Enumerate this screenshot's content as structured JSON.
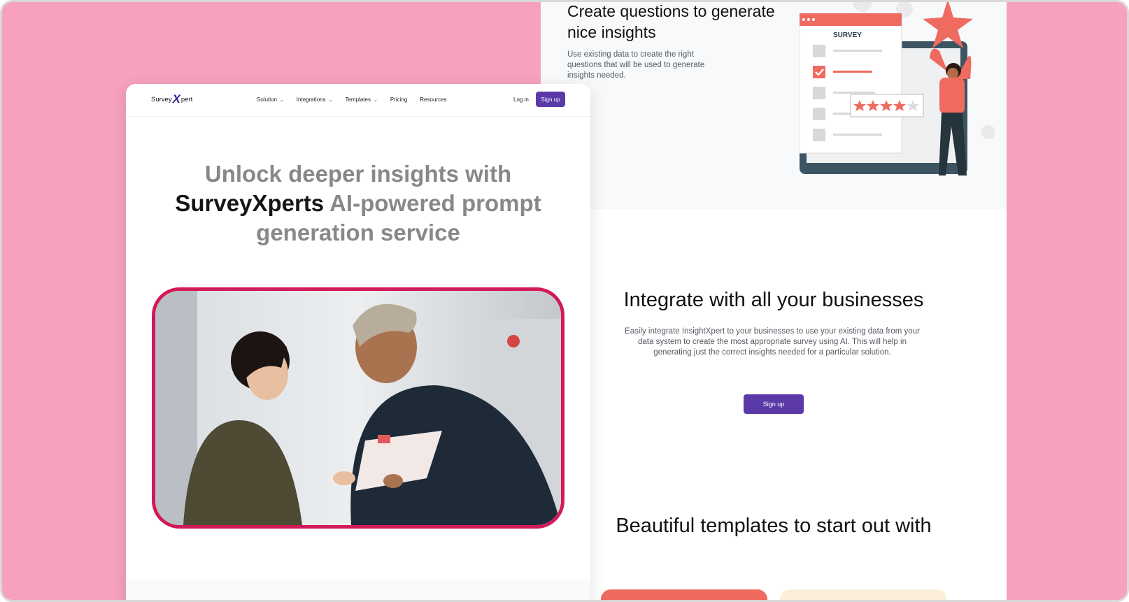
{
  "right_page": {
    "feature": {
      "title": "Create questions to generate nice insights",
      "description": "Use existing data to create the right questions that will be used to generate insights needed.",
      "illustration": {
        "survey_label": "SURVEY",
        "stars_filled": 4,
        "stars_total": 5
      }
    },
    "integrate": {
      "title": "Integrate with all your businesses",
      "description": "Easily integrate InsightXpert to your businesses to use your existing data from your data system to create the most appropriate survey using AI. This will help in generating just the correct insights needed for a particular solution.",
      "signup_label": "Sign up"
    },
    "templates": {
      "title": "Beautiful templates to start out with"
    }
  },
  "left_page": {
    "logo": {
      "part1": "Survey",
      "mark": "X",
      "part2": "pert"
    },
    "nav": [
      {
        "label": "Solution",
        "dropdown": true
      },
      {
        "label": "Integrations",
        "dropdown": true
      },
      {
        "label": "Templates",
        "dropdown": true
      },
      {
        "label": "Pricing",
        "dropdown": false
      },
      {
        "label": "Resources",
        "dropdown": false
      }
    ],
    "login_label": "Log in",
    "signup_label": "Sign up",
    "hero": {
      "line1": "Unlock deeper insights with",
      "brand": "SurveyXperts",
      "line2_rest": " AI-powered prompt",
      "line3": "generation service"
    }
  },
  "colors": {
    "background": "#f7a1bd",
    "primary": "#5b3aa8",
    "hero_border": "#d11a57",
    "accent_coral": "#ef6b5f"
  }
}
